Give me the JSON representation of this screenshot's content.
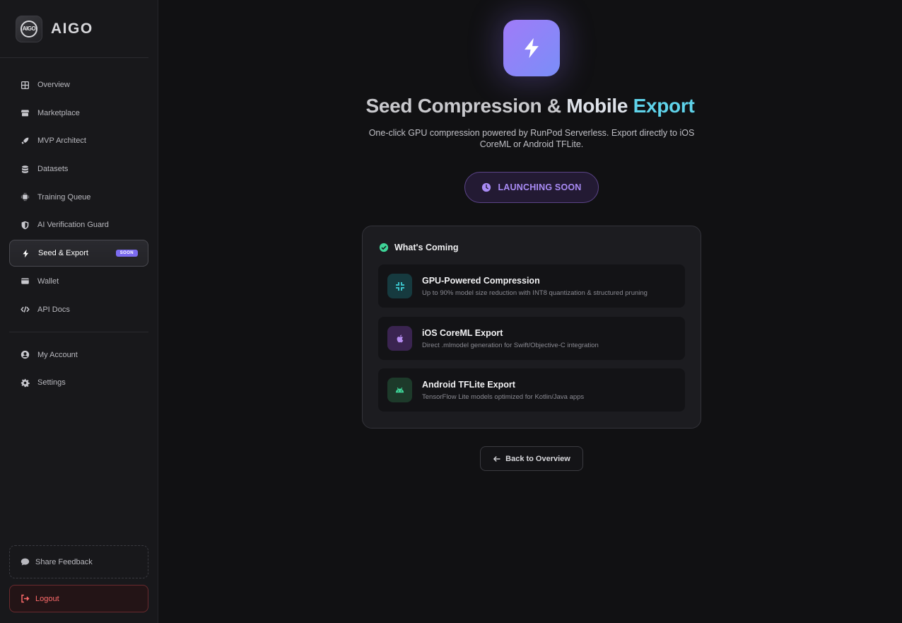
{
  "brand": {
    "logo_text": "AIGO",
    "name": "AIGO"
  },
  "sidebar": {
    "items": [
      {
        "label": "Overview",
        "icon": "grid-icon"
      },
      {
        "label": "Marketplace",
        "icon": "store-icon"
      },
      {
        "label": "MVP Architect",
        "icon": "rocket-icon"
      },
      {
        "label": "Datasets",
        "icon": "database-icon"
      },
      {
        "label": "Training Queue",
        "icon": "chip-icon"
      },
      {
        "label": "AI Verification Guard",
        "icon": "shield-icon"
      },
      {
        "label": "Seed & Export",
        "icon": "bolt-icon",
        "badge": "SOON",
        "active": true
      },
      {
        "label": "Wallet",
        "icon": "wallet-icon"
      },
      {
        "label": "API Docs",
        "icon": "code-icon"
      }
    ],
    "account_items": [
      {
        "label": "My Account",
        "icon": "user-icon"
      },
      {
        "label": "Settings",
        "icon": "gear-icon"
      }
    ],
    "feedback_label": "Share Feedback",
    "logout_label": "Logout"
  },
  "main": {
    "title_part1": "Seed Compression &",
    "title_part2": "Mobile",
    "title_part3": "Export",
    "subtitle": "One-click GPU compression powered by RunPod Serverless. Export directly to iOS CoreML or Android TFLite.",
    "launch_label": "LAUNCHING SOON",
    "card_title": "What's Coming",
    "features": [
      {
        "name": "GPU-Powered Compression",
        "desc": "Up to 90% model size reduction with INT8 quantization & structured pruning",
        "icon": "compress-icon"
      },
      {
        "name": "iOS CoreML Export",
        "desc": "Direct .mlmodel generation for Swift/Objective-C integration",
        "icon": "apple-icon"
      },
      {
        "name": "Android TFLite Export",
        "desc": "TensorFlow Lite models optimized for Kotlin/Java apps",
        "icon": "android-icon"
      }
    ],
    "back_label": "Back to Overview"
  },
  "colors": {
    "accent_purple": "#a07bf8",
    "accent_cyan": "#5fd3ea",
    "success_green": "#3ed598",
    "danger_red": "#ff6b6b"
  }
}
